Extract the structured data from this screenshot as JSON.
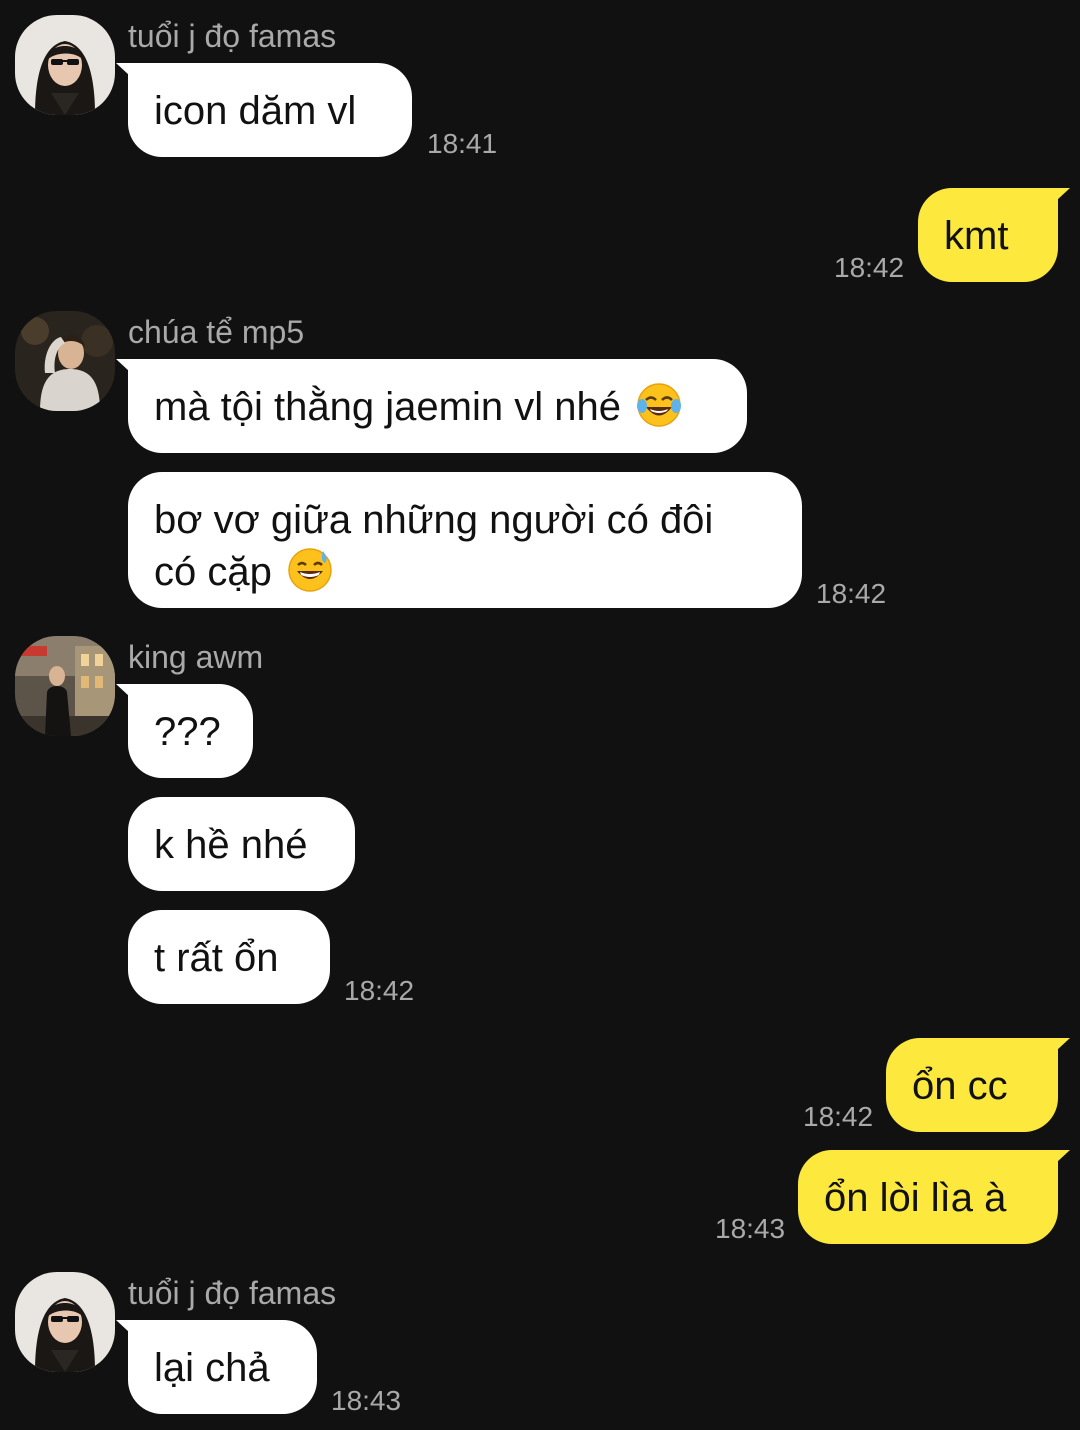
{
  "colors": {
    "background": "#111111",
    "incoming_bubble": "#ffffff",
    "outgoing_bubble": "#fde83d",
    "meta_text": "#a9a9a9",
    "message_text": "#111111"
  },
  "groups": [
    {
      "sender": "tuổi j đọ famas",
      "avatar_icon": "girl-sunglasses-avatar",
      "messages": [
        {
          "text": "icon dăm vl",
          "time": "18:41"
        }
      ]
    },
    {
      "direction": "outgoing",
      "messages": [
        {
          "text": "kmt",
          "time": "18:42"
        }
      ]
    },
    {
      "sender": "chúa tể mp5",
      "avatar_icon": "boy-hand-on-head-avatar",
      "messages": [
        {
          "text": "mà tội thằng jaemin vl nhé",
          "emoji": "face-with-tears-of-joy"
        },
        {
          "text_line1": "bơ vơ giữa những người có đôi",
          "text_line2": "có cặp",
          "emoji": "grinning-face-with-sweat",
          "time": "18:42"
        }
      ]
    },
    {
      "sender": "king awm",
      "avatar_icon": "street-photo-avatar",
      "messages": [
        {
          "text": "???"
        },
        {
          "text": "k hề nhé"
        },
        {
          "text": "t rất ổn",
          "time": "18:42"
        }
      ]
    },
    {
      "direction": "outgoing",
      "messages": [
        {
          "text": "ổn cc",
          "time": "18:42"
        },
        {
          "text": "ổn lòi lìa à",
          "time": "18:43"
        }
      ]
    },
    {
      "sender": "tuổi j đọ famas",
      "avatar_icon": "girl-sunglasses-avatar",
      "messages": [
        {
          "text": "lại chả",
          "time": "18:43"
        }
      ]
    }
  ]
}
